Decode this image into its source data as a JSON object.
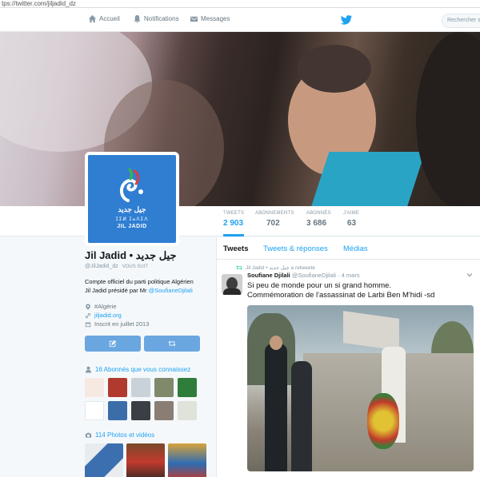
{
  "browser": {
    "url": "tps://twitter.com/jiljadid_dz"
  },
  "nav": {
    "home_label": "Accueil",
    "notifications_label": "Notifications",
    "messages_label": "Messages",
    "search_placeholder": "Rechercher s"
  },
  "profile": {
    "name": "Jil Jadid • جيل جديد",
    "handle": "@JilJadid_dz",
    "follows_you": "VOUS SUIT",
    "bio_line1": "Compte officiel du parti politique Algérien",
    "bio_line2_prefix": "Jil Jadid présidé par Mr ",
    "bio_mention": "@SoufianeDjilali",
    "hashtag": "#Algérie",
    "website": "jiljadid.org",
    "joined": "Inscrit en juillet 2013",
    "logo_arabic": "جيل جديد",
    "logo_tifinagh": "ⵊⵉⵍ ⵊⴰⴷⵉⴷ",
    "logo_latin": "JIL JADID"
  },
  "stats": [
    {
      "label": "TWEETS",
      "value": "2 903"
    },
    {
      "label": "ABONNEMENTS",
      "value": "702"
    },
    {
      "label": "ABONNÉS",
      "value": "3 686"
    },
    {
      "label": "J'AIME",
      "value": "63"
    }
  ],
  "followers_you_know": "16 Abonnés que vous connaissez",
  "photos_videos": "114 Photos et vidéos",
  "tabs": [
    "Tweets",
    "Tweets & réponses",
    "Médias"
  ],
  "tweet": {
    "retweet_note": "Jil Jadid • جيل جديد a retweeté",
    "author_name": "Soufiane Djilali",
    "author_handle": "@SoufianeDjilali",
    "date": "· 4 mars",
    "text_line1": "Si peu de monde pour un si grand homme.",
    "text_line2": "Commémoration de l'assassinat de Larbi Ben M'hidi -sd"
  },
  "colors": {
    "accent": "#1da1f2",
    "button": "#6aa6e0",
    "retweet_green": "#19cf86"
  }
}
